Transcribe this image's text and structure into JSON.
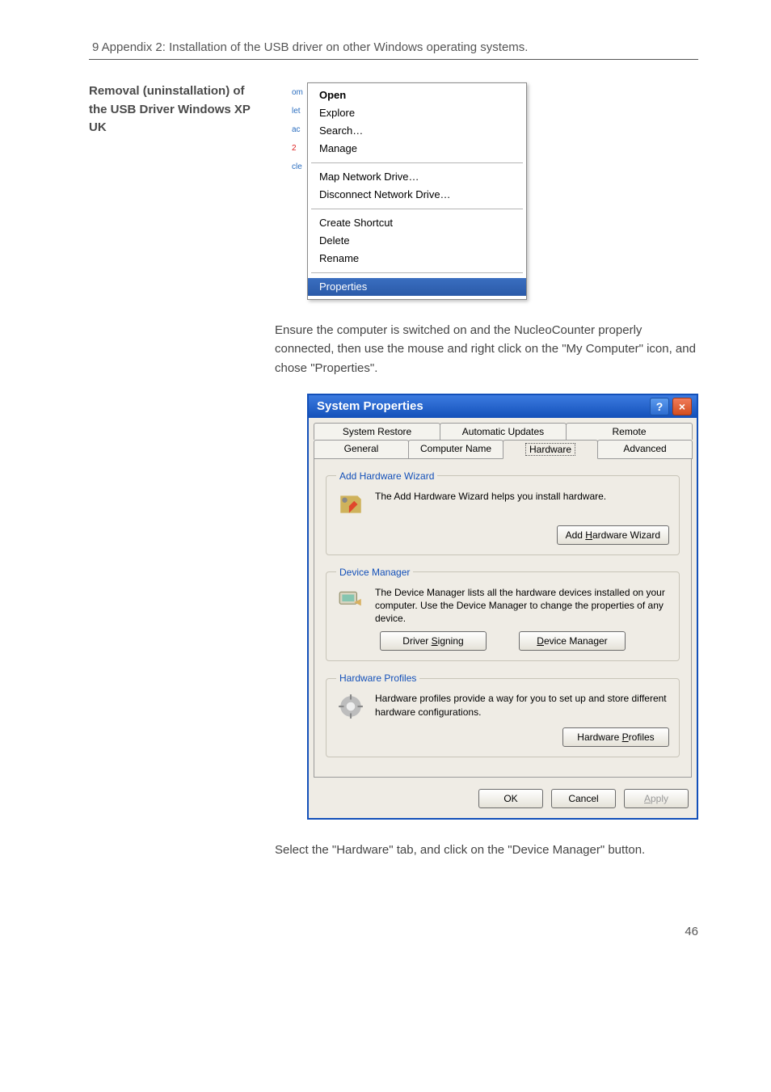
{
  "header": "9 Appendix 2: Installation of the USB driver on other Windows operating systems.",
  "sidebar_title": "Removal (uninstallation) of the USB Driver Windows XP UK",
  "context_menu": {
    "items_group1": [
      "Open",
      "Explore",
      "Search…",
      "Manage"
    ],
    "items_group2": [
      "Map Network Drive…",
      "Disconnect Network Drive…"
    ],
    "items_group3": [
      "Create Shortcut",
      "Delete",
      "Rename"
    ],
    "selected": "Properties"
  },
  "paragraph1": "Ensure the computer is switched on and the NucleoCounter properly connected, then use the mouse and right click on the \"My Computer\" icon, and chose \"Properties\".",
  "dialog": {
    "title": "System Properties",
    "tabs_row1": [
      "System Restore",
      "Automatic Updates",
      "Remote"
    ],
    "tabs_row2": [
      "General",
      "Computer Name",
      "Hardware",
      "Advanced"
    ],
    "active_tab": "Hardware",
    "groups": {
      "hw_wizard": {
        "legend": "Add Hardware Wizard",
        "text": "The Add Hardware Wizard helps you install hardware.",
        "button": "Add Hardware Wizard"
      },
      "dev_mgr": {
        "legend": "Device Manager",
        "text": "The Device Manager lists all the hardware devices installed on your computer. Use the Device Manager to change the properties of any device.",
        "button_left": "Driver Signing",
        "button_right": "Device Manager"
      },
      "hw_profiles": {
        "legend": "Hardware Profiles",
        "text": "Hardware profiles provide a way for you to set up and store different hardware configurations.",
        "button": "Hardware Profiles"
      }
    },
    "footer": {
      "ok": "OK",
      "cancel": "Cancel",
      "apply": "Apply"
    }
  },
  "paragraph2": "Select the \"Hardware\" tab, and click on the \"Device Manager\" button.",
  "page_number": "46"
}
